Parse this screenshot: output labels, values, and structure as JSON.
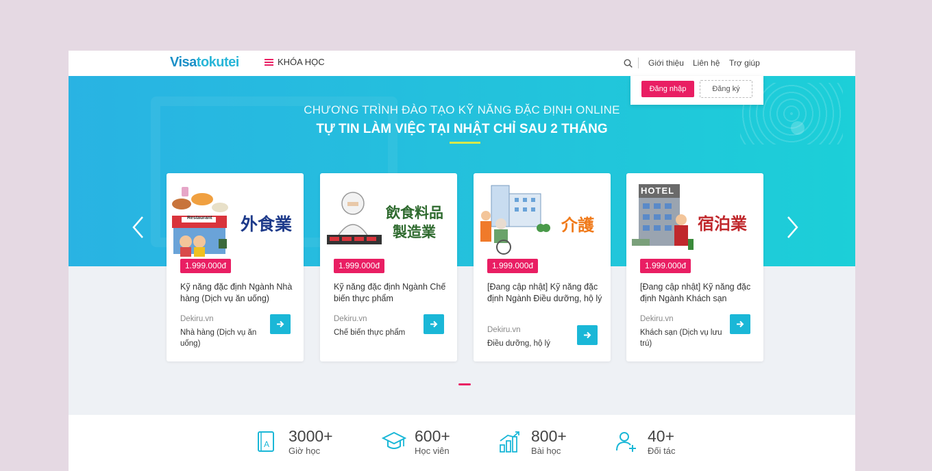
{
  "header": {
    "logo_part1": "Visa",
    "logo_part2": "tokutei",
    "courses_menu": "KHÓA HỌC",
    "nav": [
      "Giới thiệu",
      "Liên hệ",
      "Trợ giúp"
    ],
    "login": "Đăng nhập",
    "register": "Đăng ký"
  },
  "hero": {
    "subtitle": "CHƯƠNG TRÌNH ĐÀO TẠO KỸ NĂNG ĐẶC ĐỊNH ONLINE",
    "title": "TỰ TIN LÀM VIỆC TẠI NHẬT CHỈ SAU 2 THÁNG"
  },
  "cards": [
    {
      "image_text": "外食業",
      "image_sign": "Restaurant",
      "price": "1.999.000đ",
      "title": "Kỹ năng đặc định Ngành Nhà hàng (Dịch vụ ăn uống)",
      "provider": "Dekiru.vn",
      "category": "Nhà hàng (Dịch vụ ăn uống)"
    },
    {
      "image_text_1": "飲食料品",
      "image_text_2": "製造業",
      "price": "1.999.000đ",
      "title": "Kỹ năng đặc định Ngành Chế biến thực phẩm",
      "provider": "Dekiru.vn",
      "category": "Chế biến thực phẩm"
    },
    {
      "image_text": "介護",
      "price": "1.999.000đ",
      "title": "[Đang cập nhật] Kỹ năng đặc định Ngành Điều dưỡng, hộ lý",
      "provider": "Dekiru.vn",
      "category": "Điều dưỡng, hộ lý"
    },
    {
      "image_text": "宿泊業",
      "image_sign": "HOTEL",
      "price": "1.999.000đ",
      "title": "[Đang cập nhật] Kỹ năng đặc định Ngành Khách sạn",
      "provider": "Dekiru.vn",
      "category": "Khách sạn (Dịch vụ lưu trú)"
    }
  ],
  "stats": [
    {
      "value": "3000+",
      "label": "Giờ học",
      "icon": "book-icon"
    },
    {
      "value": "600+",
      "label": "Học viên",
      "icon": "graduation-cap-icon"
    },
    {
      "value": "800+",
      "label": "Bài học",
      "icon": "growth-chart-icon"
    },
    {
      "value": "40+",
      "label": "Đối tác",
      "icon": "add-user-icon"
    }
  ],
  "colors": {
    "accent": "#e91e63",
    "primary": "#1ab7d7",
    "logo_dark": "#1a8fc7"
  }
}
